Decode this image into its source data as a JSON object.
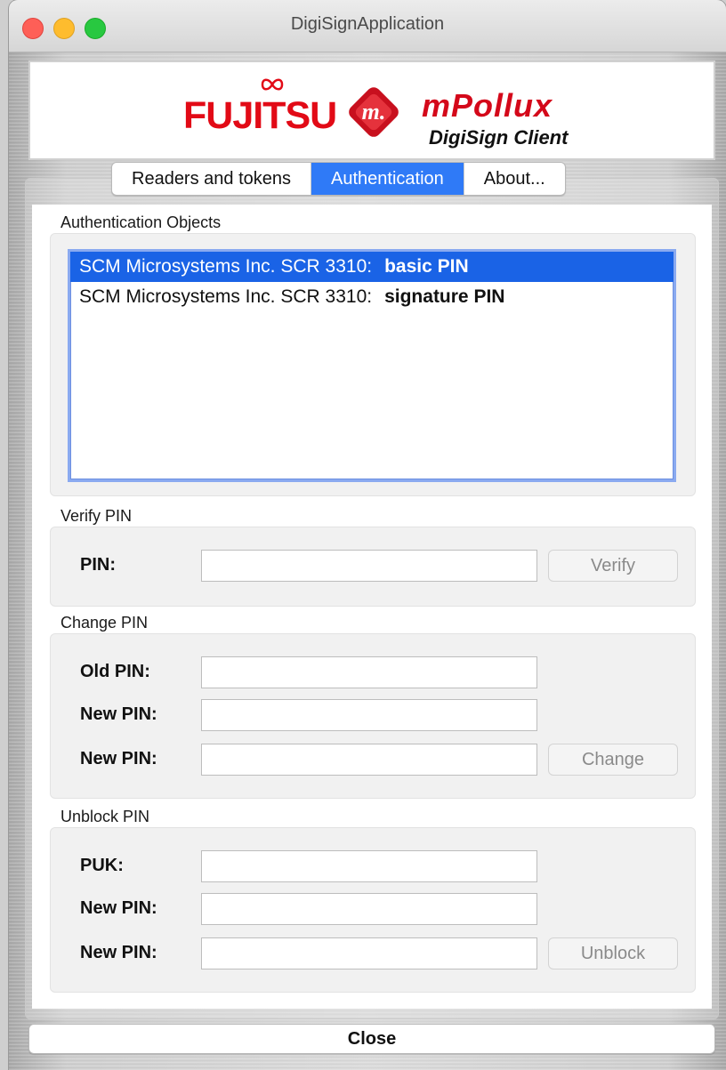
{
  "window": {
    "title": "DigiSignApplication"
  },
  "banner": {
    "brand": "FUJITSU",
    "logo_letter": "m.",
    "product": "mPollux",
    "subtitle": "DigiSign Client"
  },
  "tabs": [
    {
      "label": "Readers and tokens",
      "active": false
    },
    {
      "label": "Authentication",
      "active": true
    },
    {
      "label": "About...",
      "active": false
    }
  ],
  "auth_objects": {
    "label": "Authentication Objects",
    "items": [
      {
        "reader": "SCM Microsystems Inc. SCR 3310:",
        "name": "basic PIN",
        "selected": true
      },
      {
        "reader": "SCM Microsystems Inc. SCR 3310:",
        "name": "signature PIN",
        "selected": false
      }
    ]
  },
  "verify": {
    "label": "Verify PIN",
    "pin_label": "PIN:",
    "button": "Verify"
  },
  "change": {
    "label": "Change PIN",
    "old_label": "Old PIN:",
    "new_label": "New PIN:",
    "new2_label": "New PIN:",
    "button": "Change"
  },
  "unblock": {
    "label": "Unblock PIN",
    "puk_label": "PUK:",
    "new_label": "New PIN:",
    "new2_label": "New PIN:",
    "button": "Unblock"
  },
  "close_button": "Close",
  "colors": {
    "accent": "#2f7af7",
    "selection": "#1a63e6",
    "brand_red": "#e20a16"
  }
}
